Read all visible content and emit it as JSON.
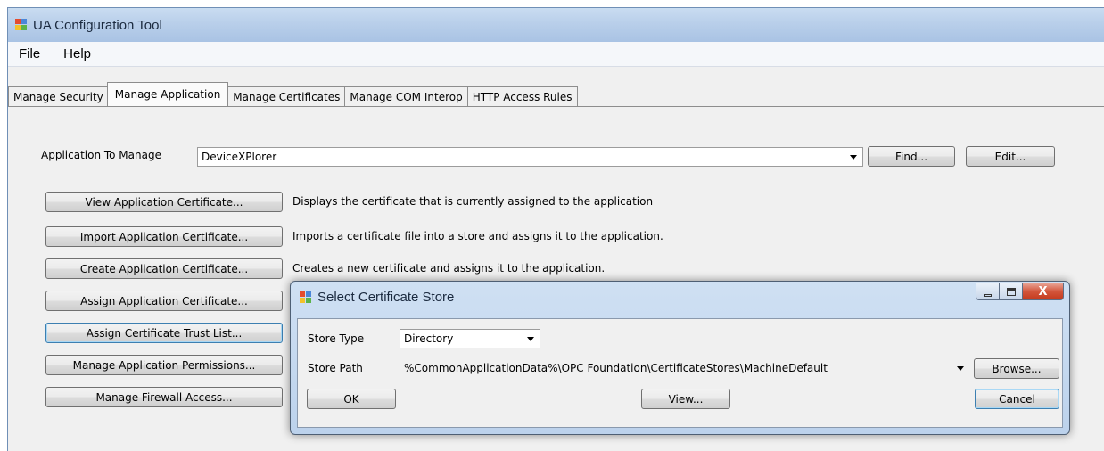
{
  "window": {
    "title": "UA Configuration Tool"
  },
  "menu": [
    "File",
    "Help"
  ],
  "tabs": [
    {
      "label": "Manage Security",
      "active": false
    },
    {
      "label": "Manage Application",
      "active": true
    },
    {
      "label": "Manage Certificates",
      "active": false
    },
    {
      "label": "Manage COM Interop",
      "active": false
    },
    {
      "label": "HTTP Access Rules",
      "active": false
    }
  ],
  "app_select": {
    "label": "Application To Manage",
    "value": "DeviceXPlorer"
  },
  "buttons": {
    "find": "Find...",
    "edit": "Edit..."
  },
  "actions": [
    {
      "button": "View Application Certificate...",
      "description": "Displays the certificate that is currently assigned to the application"
    },
    {
      "button": "Import Application Certificate...",
      "description": "Imports a certificate file into a store and assigns it to the application."
    },
    {
      "button": "Create Application Certificate...",
      "description": "Creates a new certificate and assigns it to the application."
    },
    {
      "button": "Assign Application Certificate...",
      "description": ""
    },
    {
      "button": "Assign Certificate Trust List...",
      "description": ""
    },
    {
      "button": "Manage Application Permissions...",
      "description": ""
    },
    {
      "button": "Manage Firewall Access...",
      "description": ""
    }
  ],
  "dialog": {
    "title": "Select Certificate Store",
    "store_type_label": "Store Type",
    "store_type_value": "Directory",
    "store_path_label": "Store Path",
    "store_path_value": "%CommonApplicationData%\\OPC Foundation\\CertificateStores\\MachineDefault",
    "browse": "Browse...",
    "ok": "OK",
    "view": "View...",
    "cancel": "Cancel",
    "close_glyph": "X"
  },
  "colors": {
    "titlebar": "#b9cfea",
    "window_bg": "#f0f0f0",
    "close_button": "#c43a1e"
  }
}
